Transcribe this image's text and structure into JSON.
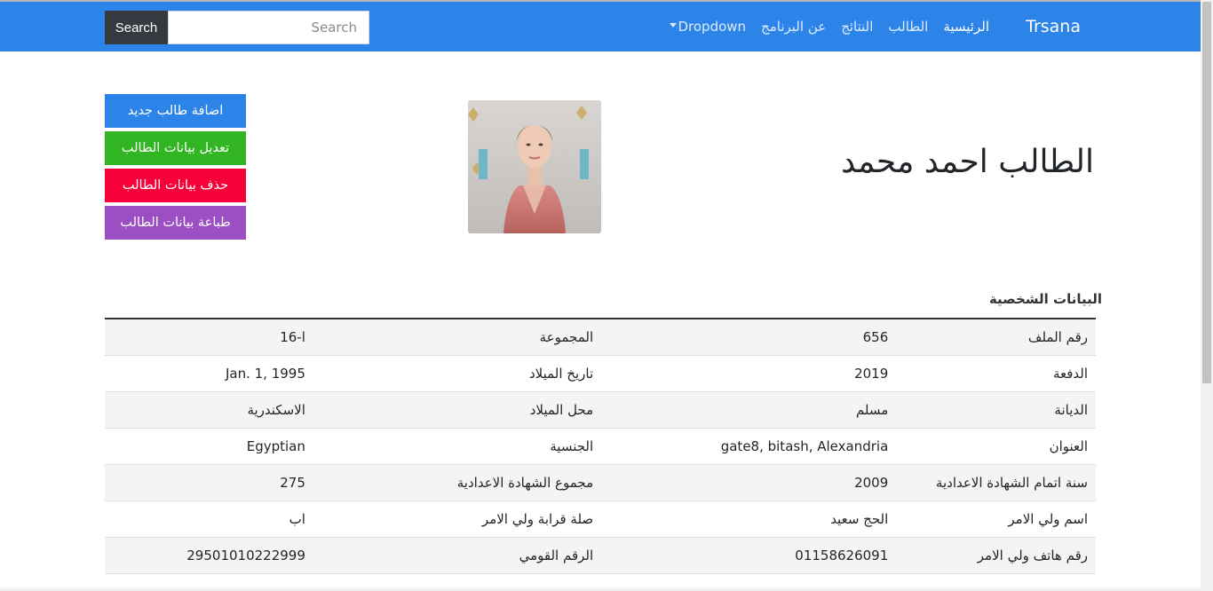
{
  "navbar": {
    "brand": "Trsana",
    "links": [
      "الرئيسية",
      "الطالب",
      "النتائج",
      "عن البرنامج"
    ],
    "dropdown_label": "Dropdown",
    "search_placeholder": "Search",
    "search_button": "Search",
    "color": "#2d84e8"
  },
  "student": {
    "title": "الطالب احمد محمد",
    "photo_description": "student-photo"
  },
  "actions": {
    "add": "اضافة طالب جديد",
    "edit": "تعديل بيانات الطالب",
    "delete": "حذف بيانات الطالب",
    "print": "طباعة بيانات الطالب"
  },
  "colors": {
    "add": "#2d84e8",
    "edit": "#32b522",
    "delete": "#f8003a",
    "print": "#9b4fc2"
  },
  "section_title": "البيانات الشخصية",
  "rows": [
    {
      "label1": "رقم الملف",
      "value1": "656",
      "label2": "المجموعة",
      "value2": "ا-16"
    },
    {
      "label1": "الدفعة",
      "value1": "2019",
      "label2": "تاريخ الميلاد",
      "value2": "Jan. 1, 1995"
    },
    {
      "label1": "الديانة",
      "value1": "مسلم",
      "label2": "محل الميلاد",
      "value2": "الاسكندرية"
    },
    {
      "label1": "العنوان",
      "value1": "gate8, bitash, Alexandria",
      "label2": "الجنسية",
      "value2": "Egyptian"
    },
    {
      "label1": "سنة اتمام الشهادة الاعدادية",
      "value1": "2009",
      "label2": "مجموع الشهادة الاعدادية",
      "value2": "275"
    },
    {
      "label1": "اسم ولي الامر",
      "value1": "الحج سعيد",
      "label2": "صلة قرابة ولي الامر",
      "value2": "اب"
    },
    {
      "label1": "رقم هاتف ولي الامر",
      "value1": "01158626091",
      "label2": "الرقم القومي",
      "value2": "29501010222999"
    }
  ]
}
